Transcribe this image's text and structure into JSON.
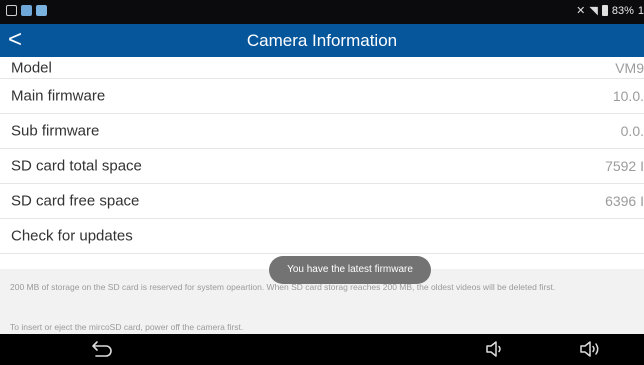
{
  "status_bar": {
    "battery": "83%",
    "time_partial": "1"
  },
  "header": {
    "back_symbol": "<",
    "title": "Camera Information"
  },
  "rows": [
    {
      "label": "Model",
      "value": "VM9"
    },
    {
      "label": "Main firmware",
      "value": "10.0."
    },
    {
      "label": "Sub firmware",
      "value": "0.0."
    },
    {
      "label": "SD card total space",
      "value": "7592 I"
    },
    {
      "label": "SD card free space",
      "value": "6396 I"
    },
    {
      "label": "Check for updates",
      "value": ""
    }
  ],
  "notes": {
    "line1": "200 MB of storage on the SD card is reserved for system opeartion. When SD card storag reaches 200 MB, the oldest videos will be deleted first.",
    "line2": "To insert or eject the mircoSD card, power off the camera first."
  },
  "toast": "You have the latest firmware",
  "colors": {
    "app_bar": "#06569c",
    "status_bar": "#0b0b0d",
    "toast": "#737373"
  },
  "nav_icons": [
    "back-arrow-icon",
    "volume-down-icon",
    "volume-up-icon"
  ]
}
